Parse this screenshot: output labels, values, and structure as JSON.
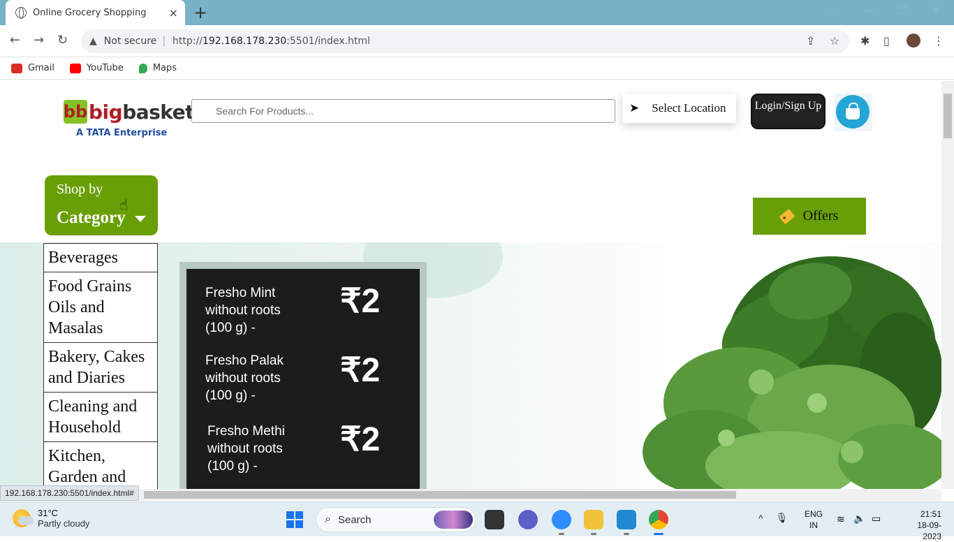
{
  "browser": {
    "tab_title": "Online Grocery Shopping",
    "tab_close": "×",
    "new_tab": "+",
    "window_controls": [
      "⌵",
      "—",
      "❐",
      "✕"
    ],
    "security_label": "Not secure",
    "url_prefix": "http://",
    "url_host": "192.168.178.230",
    "url_rest": ":5501/index.html",
    "bookmarks": [
      {
        "label": "Gmail",
        "icon": "gmail-icon",
        "color": "#d93025"
      },
      {
        "label": "YouTube",
        "icon": "youtube-icon",
        "color": "#ff0000"
      },
      {
        "label": "Maps",
        "icon": "maps-icon",
        "color": "#34a853"
      }
    ],
    "status_url": "192.168.178.230:5501/index.html#"
  },
  "header": {
    "logo_big": "big",
    "logo_basket": "basket",
    "logo_mark": "bb",
    "logo_tagline": "A TATA Enterprise",
    "search_placeholder": "Search For Products...",
    "location_label": "Select Location",
    "login_label": "Login/Sign Up"
  },
  "nav": {
    "shop_by_line1": "Shop by",
    "shop_by_line2": "Category",
    "offers_label": "Offers"
  },
  "categories": [
    "Beverages",
    "Food Grains Oils and Masalas",
    "Bakery, Cakes and Diaries",
    "Cleaning and Household",
    "Kitchen, Garden and"
  ],
  "banner": {
    "items": [
      {
        "name": "Fresho Mint without roots (100 g) -",
        "price": "₹2"
      },
      {
        "name": "Fresho Palak without roots (100 g) -",
        "price": "₹2"
      },
      {
        "name": "Fresho Methi without roots (100 g) -",
        "price": "₹2"
      }
    ]
  },
  "taskbar": {
    "temperature": "31°C",
    "weather": "Partly cloudy",
    "search_label": "Search",
    "lang1": "ENG",
    "lang2": "IN",
    "time": "21:51",
    "date": "18-09-2023"
  },
  "colors": {
    "brand_green": "#689f06",
    "brand_red": "#b01e23",
    "cart_blue": "#23a6d5"
  }
}
